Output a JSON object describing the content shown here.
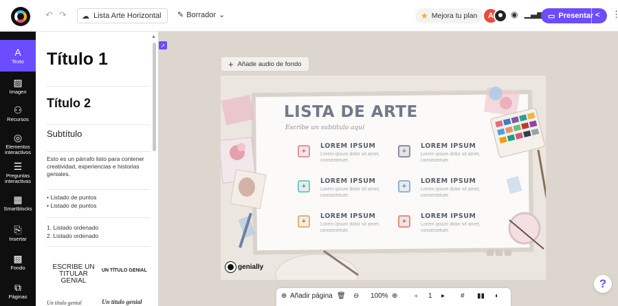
{
  "topbar": {
    "presentation_title": "Lista Arte Horizontal",
    "status_label": "Borrador",
    "upgrade_label": "Mejora tu plan",
    "avatar_initial": "A",
    "present_label": "Presentar"
  },
  "iconbar": {
    "items": [
      {
        "label": "Texto",
        "icon": "A"
      },
      {
        "label": "Imagen",
        "icon": "▨"
      },
      {
        "label": "Recursos",
        "icon": "⚇"
      },
      {
        "label": "Elementos interactivos",
        "icon": "◎"
      },
      {
        "label": "Preguntas interactivas",
        "icon": "☰"
      },
      {
        "label": "Smartblocks",
        "icon": "▦"
      },
      {
        "label": "Insertar",
        "icon": "⎘"
      },
      {
        "label": "Fondo",
        "icon": "▩"
      },
      {
        "label": "Páginas",
        "icon": "⧉"
      }
    ]
  },
  "text_panel": {
    "title1": "Título 1",
    "title2": "Título 2",
    "subtitle": "Subtítulo",
    "paragraph": "Esto es un párrafo listo para contener creatividad, experiencias e historias geniales.",
    "bullets": [
      "Listado de puntos",
      "Listado de puntos"
    ],
    "ordered": [
      "1. Listado ordenado",
      "2. Listado ordenado"
    ],
    "thumb_a": "ESCRIBE UN TITULAR GENIAL",
    "thumb_b": "UN TÍTULO GENIAL",
    "thumb_c": "Un título genial",
    "thumb_d": "Un título genial"
  },
  "canvas": {
    "audio_button": "Añade audio de fondo",
    "slide_title": "LISTA DE ARTE",
    "slide_subtitle": "Escribe un subtítulo aquí",
    "items": [
      {
        "heading": "LOREM IPSUM",
        "text": "Lorem ipsum dolor sit amet, consectetuer.",
        "symbol": "+",
        "color": "#e88fa0"
      },
      {
        "heading": "LOREM IPSUM",
        "text": "Lorem ipsum dolor sit amet, consectetuer.",
        "symbol": "+",
        "color": "#8f8aa8"
      },
      {
        "heading": "LOREM IPSUM",
        "text": "Lorem ipsum dolor sit amet, consectetuer.",
        "symbol": "+",
        "color": "#7fc3c8"
      },
      {
        "heading": "LOREM IPSUM",
        "text": "Lorem ipsum dolor sit amet, consectetuer.",
        "symbol": "+",
        "color": "#8fb3d8"
      },
      {
        "heading": "LOREM IPSUM",
        "text": "Lorem ipsum dolor sit amet, consectetuer.",
        "symbol": "+",
        "color": "#e0b27a"
      },
      {
        "heading": "LOREM IPSUM",
        "text": "Lorem ipsum dolor sit amet, consectetuer.",
        "symbol": "+",
        "color": "#e58a86"
      }
    ],
    "brand": "genially"
  },
  "bottombar": {
    "add_page_label": "Añadir página",
    "zoom": "100%",
    "page_number": "1"
  },
  "colors": {
    "accent": "#6c4cff",
    "workspace": "#ddd6cf"
  }
}
